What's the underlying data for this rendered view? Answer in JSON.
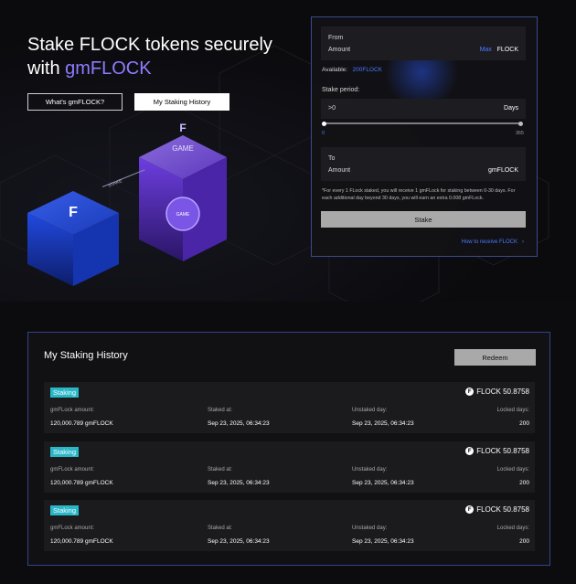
{
  "hero": {
    "title_line1": "Stake FLOCK tokens securely",
    "title_prefix": "with ",
    "title_accent": "gmFLOCK",
    "btn_whats": "What's gmFLOCK?",
    "btn_history": "My Staking History"
  },
  "illustration": {
    "game_label": "GAME",
    "rope_label": "STAKE",
    "coin_label": "GAME"
  },
  "stake_panel": {
    "from_label": "From",
    "amount_label": "Amount",
    "max_label": "Max",
    "token_label": "FLOCK",
    "available_label": "Available:",
    "available_value": "200FLOCK",
    "period_label": "Stake period:",
    "period_placeholder": ">0",
    "period_unit": "Days",
    "slider_min": "0",
    "slider_max": "365",
    "slider_value": 0,
    "to_label": "To",
    "to_amount_label": "Amount",
    "to_token_label": "gmFLOCK",
    "note": "*For every 1 FLock staked, you will receive 1 gmFLock for staking between 0-30 days. For each additional day beyond 30 days, you will earn an extra 0.008 gmFLock.",
    "stake_button": "Stake",
    "receive_link": "How to receive FLOCK"
  },
  "history": {
    "title": "My Staking History",
    "redeem_button": "Redeem",
    "headers": {
      "gm_amount": "gmFLock amount:",
      "staked_at": "Staked at:",
      "unstaked_day": "Unstaked day:",
      "locked_days": "Locked days:"
    },
    "records": [
      {
        "status": "Staking",
        "amount": "FLOCK 50.8758",
        "gm_amount": "120,000.789 gmFLOCK",
        "staked_at": "Sep 23, 2025, 06:34:23",
        "unstaked_day": "Sep 23, 2025, 06:34:23",
        "locked_days": "200"
      },
      {
        "status": "Staking",
        "amount": "FLOCK 50.8758",
        "gm_amount": "120,000.789 gmFLOCK",
        "staked_at": "Sep 23, 2025, 06:34:23",
        "unstaked_day": "Sep 23, 2025, 06:34:23",
        "locked_days": "200"
      },
      {
        "status": "Staking",
        "amount": "FLOCK 50.8758",
        "gm_amount": "120,000.789 gmFLOCK",
        "staked_at": "Sep 23, 2025, 06:34:23",
        "unstaked_day": "Sep 23, 2025, 06:34:23",
        "locked_days": "200"
      }
    ]
  },
  "colors": {
    "accent_purple": "#8d7dff",
    "link_blue": "#4a78ff",
    "badge_cyan": "#29b6c6",
    "panel_border": "#3c4b8a"
  }
}
